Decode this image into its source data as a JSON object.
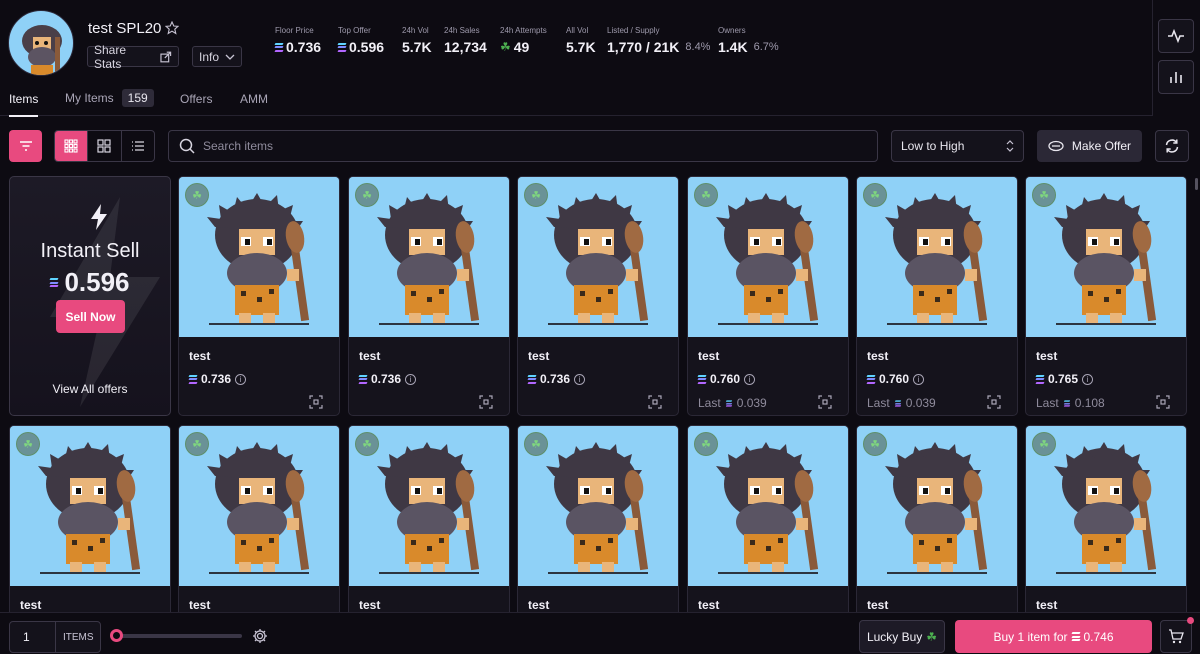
{
  "header": {
    "title": "test SPL20",
    "share_label": "Share Stats",
    "info_label": "Info",
    "stats": [
      {
        "label": "Floor Price",
        "value": "0.736",
        "currency": true
      },
      {
        "label": "Top Offer",
        "value": "0.596",
        "currency": true
      },
      {
        "label": "24h Vol",
        "value": "5.7K"
      },
      {
        "label": "24h Sales",
        "value": "12,734"
      },
      {
        "label": "24h Attempts",
        "value": "49",
        "clover": true
      },
      {
        "label": "All Vol",
        "value": "5.7K"
      },
      {
        "label": "Listed / Supply",
        "value": "1,770 / 21K",
        "pct": "8.4%"
      },
      {
        "label": "Owners",
        "value": "1.4K",
        "pct": "6.7%"
      }
    ]
  },
  "tabs": [
    {
      "label": "Items",
      "active": true
    },
    {
      "label": "My Items",
      "count": "159"
    },
    {
      "label": "Offers"
    },
    {
      "label": "AMM"
    }
  ],
  "toolbar": {
    "search_placeholder": "Search items",
    "sort_value": "Low to High",
    "make_offer_label": "Make Offer"
  },
  "instant_sell": {
    "title": "Instant Sell",
    "price": "0.596",
    "sell_label": "Sell Now",
    "view_offers_label": "View All offers"
  },
  "cards": [
    {
      "name": "test",
      "price": "0.736",
      "last": ""
    },
    {
      "name": "test",
      "price": "0.736",
      "last": ""
    },
    {
      "name": "test",
      "price": "0.736",
      "last": ""
    },
    {
      "name": "test",
      "price": "0.760",
      "last": "0.039"
    },
    {
      "name": "test",
      "price": "0.760",
      "last": "0.039"
    },
    {
      "name": "test",
      "price": "0.765",
      "last": "0.108"
    },
    {
      "name": "test"
    },
    {
      "name": "test"
    },
    {
      "name": "test"
    },
    {
      "name": "test"
    },
    {
      "name": "test"
    },
    {
      "name": "test"
    },
    {
      "name": "test"
    }
  ],
  "last_prefix": "Last",
  "bottom": {
    "quantity": "1",
    "quantity_unit": "ITEMS",
    "lucky_label": "Lucky Buy",
    "buy_label": "Buy 1 item for",
    "buy_price": "0.746"
  },
  "colors": {
    "accent": "#e84a7f",
    "background": "#0d0b12",
    "image_bg": "#8fd1f7"
  }
}
